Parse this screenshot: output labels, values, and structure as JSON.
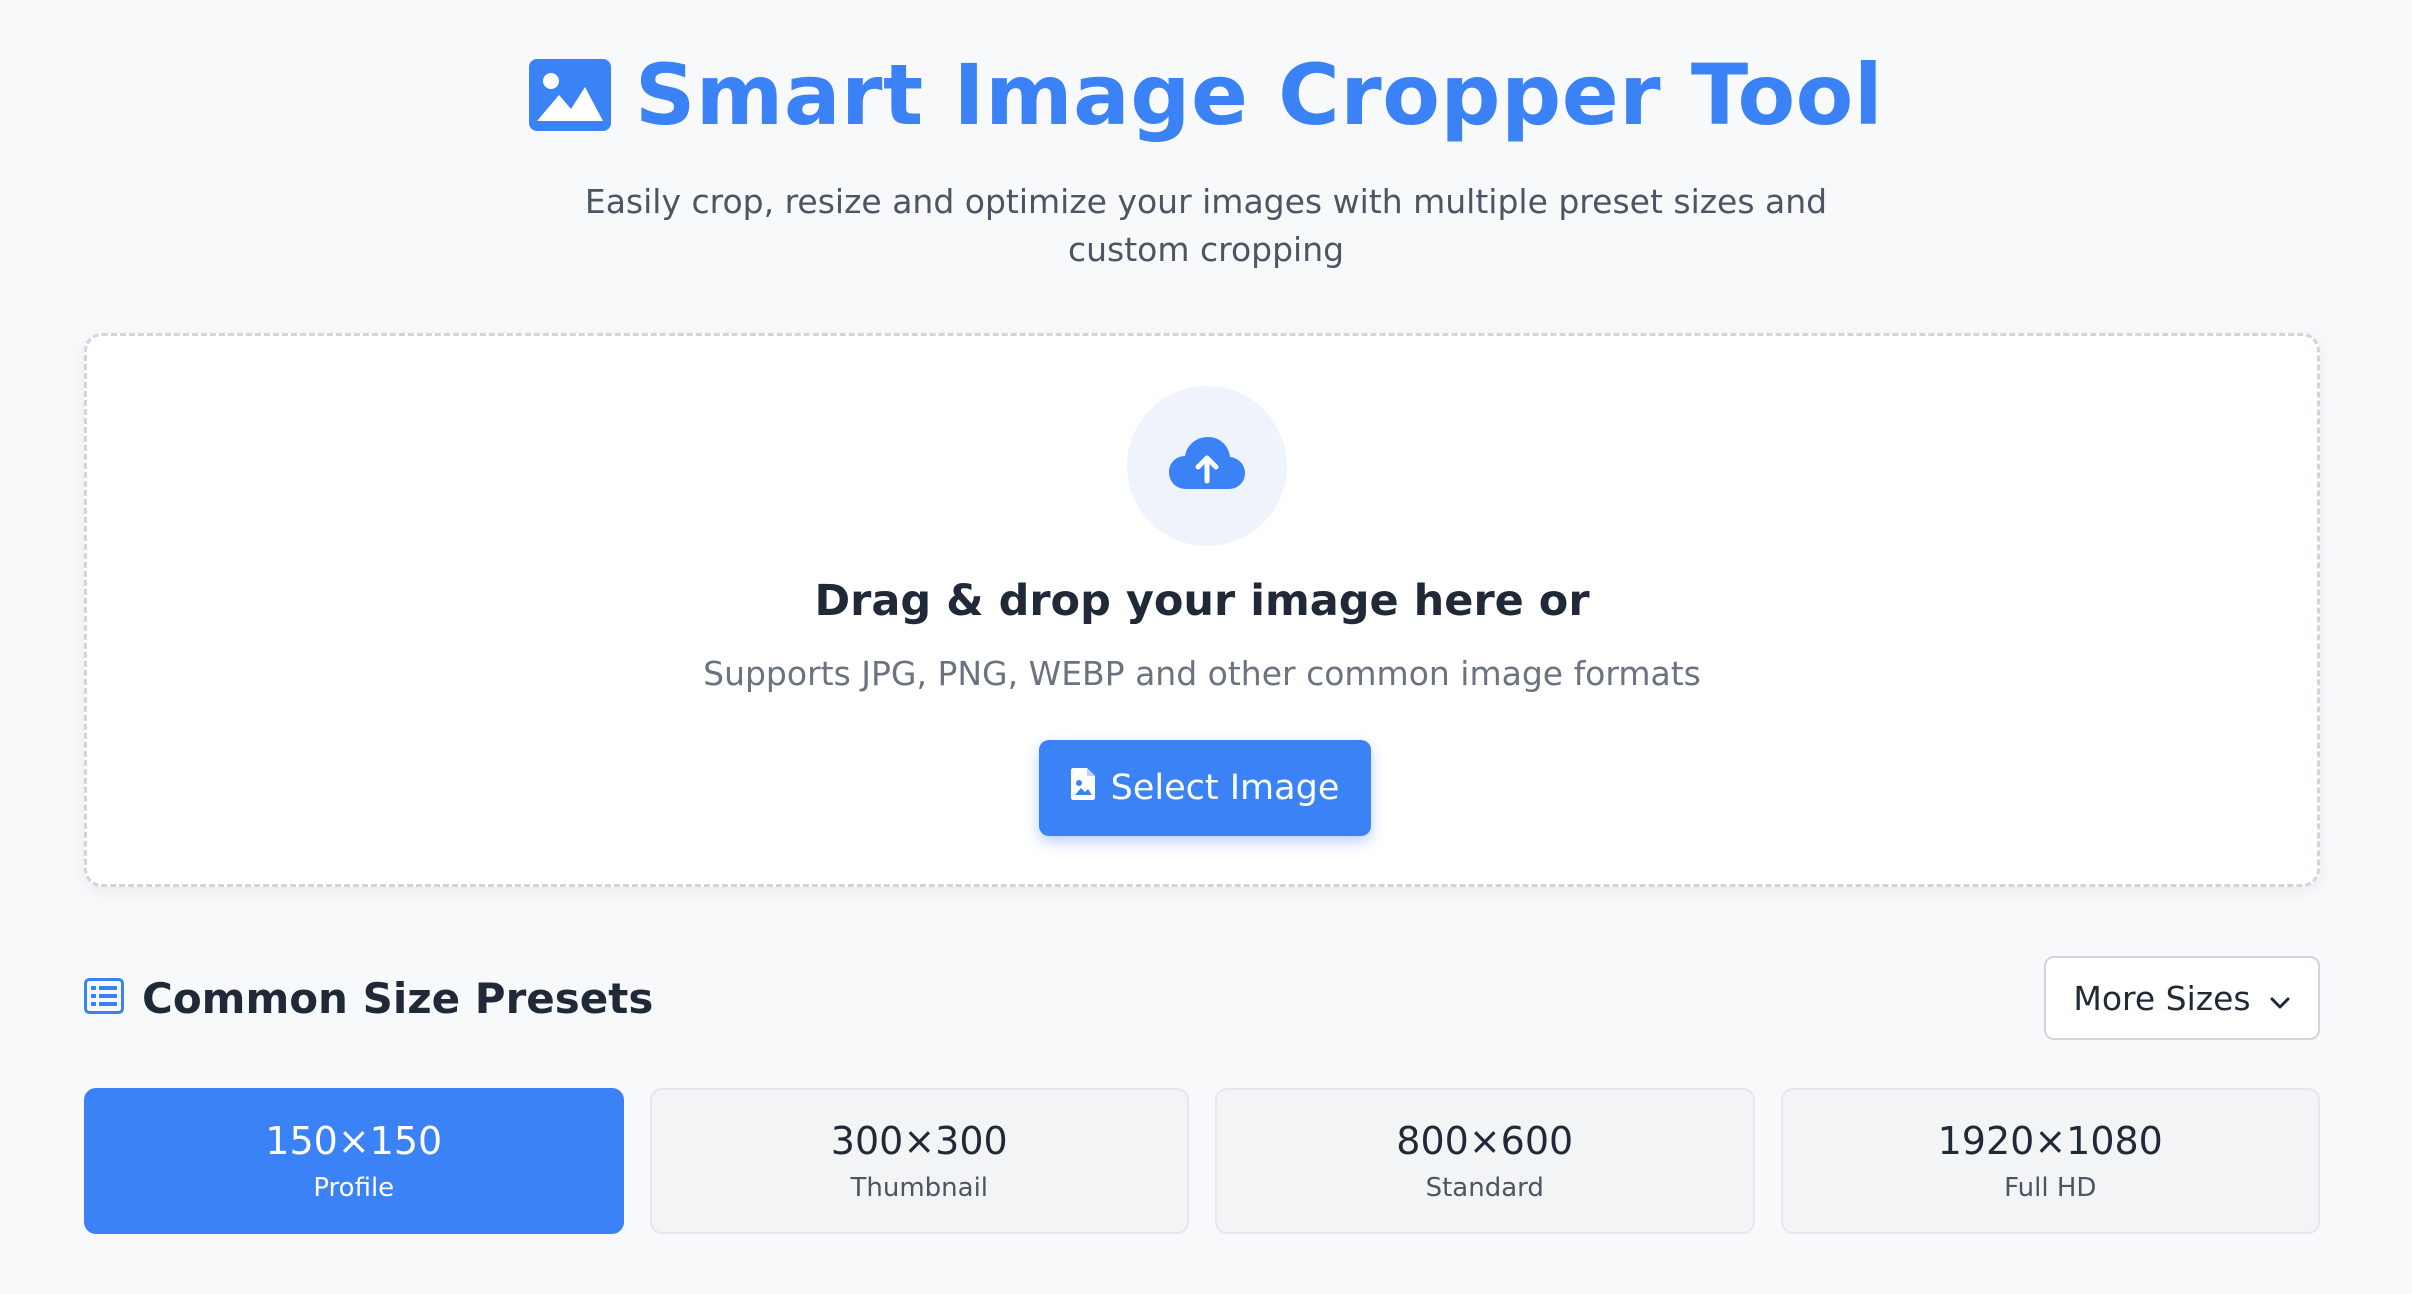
{
  "header": {
    "title": "Smart Image Cropper Tool",
    "subtitle": "Easily crop, resize and optimize your images with multiple preset sizes and custom cropping",
    "icon": "image-icon"
  },
  "dropzone": {
    "icon": "cloud-upload-icon",
    "title": "Drag & drop your image here or",
    "subtitle": "Supports JPG, PNG, WEBP and other common image formats",
    "button_label": "Select Image",
    "button_icon": "file-image-icon"
  },
  "presets": {
    "title": "Common Size Presets",
    "icon": "list-icon",
    "more_label": "More Sizes",
    "more_icon": "chevron-down-icon",
    "items": [
      {
        "size": "150×150",
        "label": "Profile",
        "active": true
      },
      {
        "size": "300×300",
        "label": "Thumbnail",
        "active": false
      },
      {
        "size": "800×600",
        "label": "Standard",
        "active": false
      },
      {
        "size": "1920×1080",
        "label": "Full HD",
        "active": false
      }
    ]
  },
  "colors": {
    "accent": "#3b82f6",
    "background": "#f8f9fb",
    "text": "#1f2937",
    "muted": "#6b7280"
  }
}
